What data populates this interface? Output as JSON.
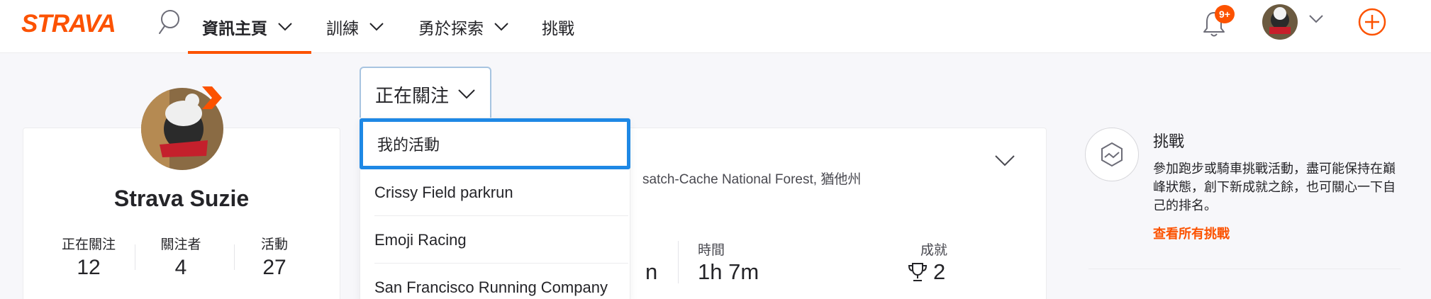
{
  "header": {
    "logo": "STRAVA",
    "nav": [
      {
        "label": "資訊主頁",
        "active": true,
        "has_chevron": true
      },
      {
        "label": "訓練",
        "active": false,
        "has_chevron": true
      },
      {
        "label": "勇於探索",
        "active": false,
        "has_chevron": true
      },
      {
        "label": "挑戰",
        "active": false,
        "has_chevron": false
      }
    ],
    "notifications_badge": "9+",
    "icons": {
      "search": "search-icon",
      "bell": "bell-icon",
      "plus": "plus-circle-icon"
    },
    "accent": "#fc5200"
  },
  "profile": {
    "name": "Strava Suzie",
    "stats": [
      {
        "label": "正在關注",
        "value": "12"
      },
      {
        "label": "關注者",
        "value": "4"
      },
      {
        "label": "活動",
        "value": "27"
      }
    ]
  },
  "feed_filter": {
    "selected": "正在關注",
    "options": [
      "我的活動",
      "Crissy Field parkrun",
      "Emoji Racing",
      "San Francisco Running Company"
    ],
    "focus_color": "#1e88e5"
  },
  "activity": {
    "location_partial": "satch-Cache National Forest, 猶他州",
    "distance_partial": "n",
    "time_label": "時間",
    "time_value": "1h 7m",
    "achievements_label": "成就",
    "achievements_value": "2"
  },
  "challenge": {
    "title": "挑戰",
    "description": "參加跑步或騎車挑戰活動，盡可能保持在巔峰狀態，創下新成就之餘，也可關心一下自己的排名。",
    "link": "查看所有挑戰"
  }
}
